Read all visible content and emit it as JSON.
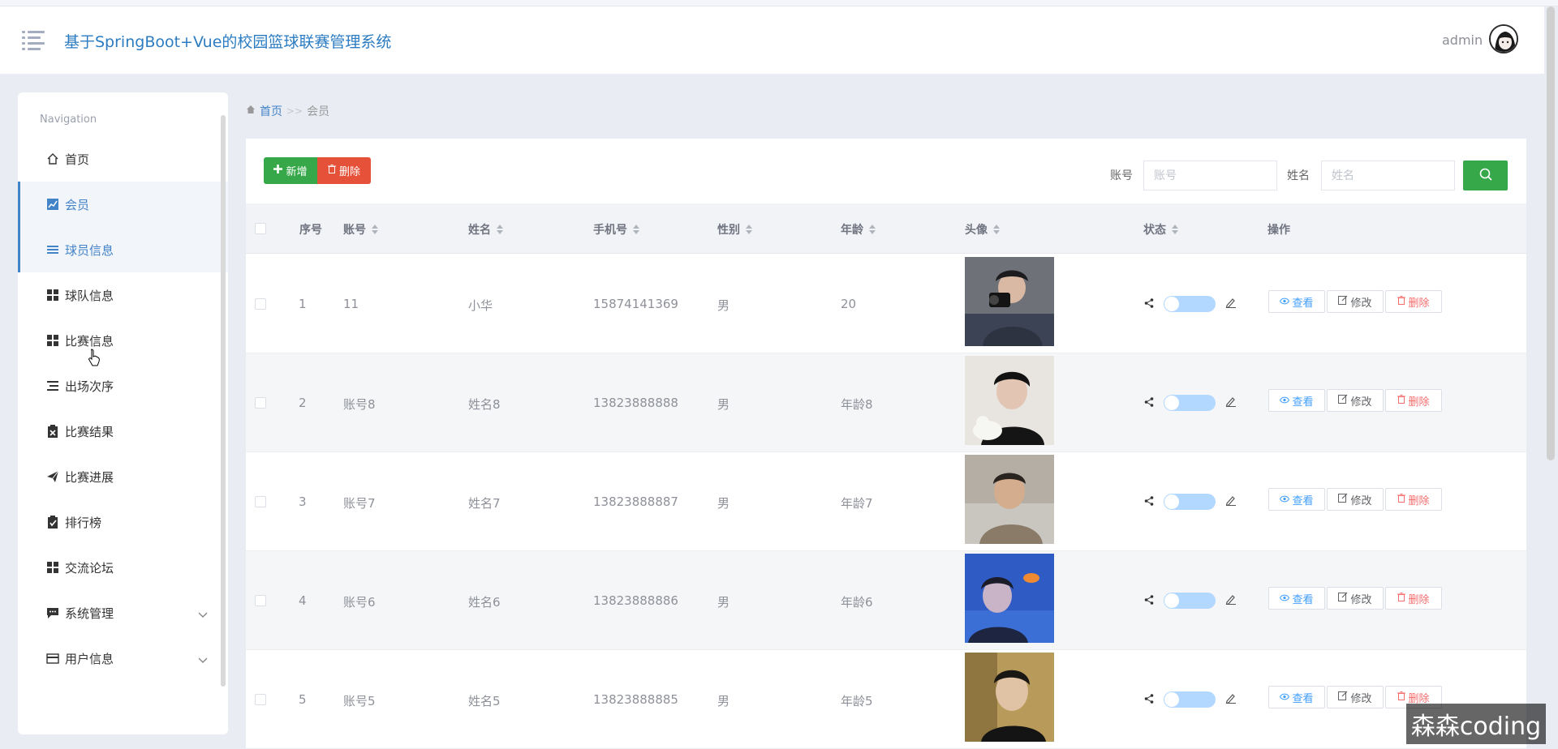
{
  "header": {
    "title": "基于SpringBoot+Vue的校园篮球联赛管理系统",
    "user": "admin"
  },
  "sidebar": {
    "nav_title": "Navigation",
    "items": [
      {
        "label": "首页",
        "icon": "home-icon"
      },
      {
        "label": "会员",
        "icon": "chart-icon"
      },
      {
        "label": "球员信息",
        "icon": "list-icon"
      },
      {
        "label": "球队信息",
        "icon": "grid-icon"
      },
      {
        "label": "比赛信息",
        "icon": "grid-icon"
      },
      {
        "label": "出场次序",
        "icon": "list-indent-icon"
      },
      {
        "label": "比赛结果",
        "icon": "clipboard-x-icon"
      },
      {
        "label": "比赛进展",
        "icon": "paper-plane-icon"
      },
      {
        "label": "排行榜",
        "icon": "clipboard-check-icon"
      },
      {
        "label": "交流论坛",
        "icon": "grid-icon"
      },
      {
        "label": "系统管理",
        "icon": "message-icon"
      },
      {
        "label": "用户信息",
        "icon": "card-icon"
      }
    ],
    "active_index": 1
  },
  "breadcrumb": {
    "home": "首页",
    "separator": ">>",
    "current": "会员"
  },
  "toolbar": {
    "add_label": "新增",
    "delete_label": "删除",
    "account_label": "账号",
    "account_placeholder": "账号",
    "name_label": "姓名",
    "name_placeholder": "姓名"
  },
  "table": {
    "columns": [
      "序号",
      "账号",
      "姓名",
      "手机号",
      "性别",
      "年龄",
      "头像",
      "状态",
      "操作"
    ],
    "rows": [
      {
        "index": "1",
        "account": "11",
        "name": "小华",
        "phone": "15874141369",
        "gender": "男",
        "age": "20"
      },
      {
        "index": "2",
        "account": "账号8",
        "name": "姓名8",
        "phone": "13823888888",
        "gender": "男",
        "age": "年龄8"
      },
      {
        "index": "3",
        "account": "账号7",
        "name": "姓名7",
        "phone": "13823888887",
        "gender": "男",
        "age": "年龄7"
      },
      {
        "index": "4",
        "account": "账号6",
        "name": "姓名6",
        "phone": "13823888886",
        "gender": "男",
        "age": "年龄6"
      },
      {
        "index": "5",
        "account": "账号5",
        "name": "姓名5",
        "phone": "13823888885",
        "gender": "男",
        "age": "年龄5"
      }
    ],
    "actions": {
      "view": "查看",
      "edit": "修改",
      "delete": "删除"
    }
  },
  "watermark": "森森coding",
  "colors": {
    "accent": "#4383c8",
    "add": "#36a84a",
    "delete": "#e6513a",
    "switch": "#b3d8ff"
  }
}
